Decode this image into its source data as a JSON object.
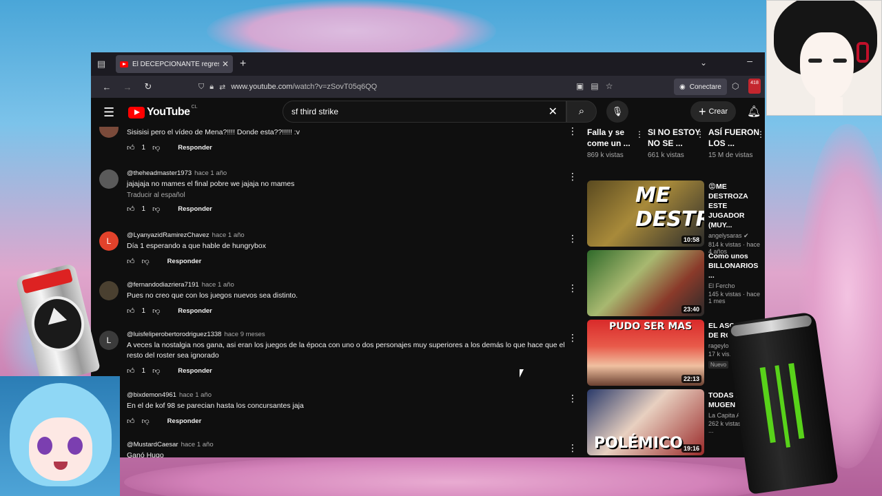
{
  "tab": {
    "title": "El DECEPCIONANTE regreso de",
    "close": "✕",
    "new": "+"
  },
  "nav": {
    "url_prefix": "www.youtube.com",
    "url_path": "/watch?v=zSovT05q6QQ",
    "connect_label": "Conectare",
    "ext_badge": "418"
  },
  "yt": {
    "logo": "YouTube",
    "country": "CL",
    "search_query": "sf third strike",
    "create_label": "Crear"
  },
  "comments": [
    {
      "handle": "",
      "ago": "",
      "text": "Sisisisi pero el vídeo de Mena?!!!! Donde esta??!!!!! :v",
      "likes": "1",
      "reply": "Responder",
      "translate": ""
    },
    {
      "handle": "@theheadmaster1973",
      "ago": "hace 1 año",
      "text": "jajajaja no mames el final pobre we jajaja no mames",
      "likes": "1",
      "reply": "Responder",
      "translate": "Traducir al español"
    },
    {
      "handle": "@LyanyazidRamirezChavez",
      "ago": "hace 1 año",
      "text": "Día 1 esperando a que hable de hungrybox",
      "likes": "",
      "reply": "Responder",
      "translate": "",
      "initial": "L"
    },
    {
      "handle": "@fernandodiazriera7191",
      "ago": "hace 1 año",
      "text": "Pues no creo que con los juegos nuevos sea distinto.",
      "likes": "1",
      "reply": "Responder",
      "translate": ""
    },
    {
      "handle": "@luisfeliperobertorodriguez1338",
      "ago": "hace 9 meses",
      "text": "A veces la nostalgia nos gana, asi eran los juegos de la época con uno o dos personajes muy superiores a los demás lo que hace que el resto del roster sea ignorado",
      "likes": "1",
      "reply": "Responder",
      "translate": "",
      "initial": "L"
    },
    {
      "handle": "@bixdemon4961",
      "ago": "hace 1 año",
      "text": "En el de kof 98 se parecian hasta los concursantes jaja",
      "likes": "",
      "reply": "Responder",
      "translate": ""
    },
    {
      "handle": "@MustardCaesar",
      "ago": "hace 1 año",
      "text": "Ganó Hugo",
      "likes": "",
      "reply": "",
      "translate": ""
    }
  ],
  "shorts": [
    {
      "title": "Falla y se come un ...",
      "views": "869 k vistas"
    },
    {
      "title": "SI NO ESTOY NO SE ...",
      "views": "661 k vistas"
    },
    {
      "title": "ASÍ FUERON LOS ...",
      "views": "15 M de vistas"
    }
  ],
  "videos": [
    {
      "title": "😡ME DESTROZA ESTE JUGADOR (MUY...",
      "channel": "angelysaras ✔",
      "meta": "814 k vistas · hace 4 años",
      "duration": "10:58",
      "thumb_text": "ME DESTROZA",
      "new": ""
    },
    {
      "title": "Como unos BILLONARIOS ...",
      "channel": "El Fercho",
      "meta": "145 k vistas · hace 1 mes",
      "duration": "23:40",
      "thumb_text": "",
      "new": ""
    },
    {
      "title": "EL ASCENSO DE ROL...",
      "channel": "rageylon",
      "meta": "17 k vis...",
      "duration": "22:13",
      "thumb_text": "PUDO SER MAS",
      "new": "Nuevo"
    },
    {
      "title": "TODAS las... de MUGEN",
      "channel": "La Capita Amb...",
      "meta": "262 k vistas · hace ...",
      "duration": "19:16",
      "thumb_text": "POLÉMICO",
      "new": ""
    }
  ],
  "colors": {
    "yt_red": "#ff0000",
    "bg": "#0f0f0f",
    "text": "#f1f1f1",
    "muted": "#aaaaaa"
  }
}
